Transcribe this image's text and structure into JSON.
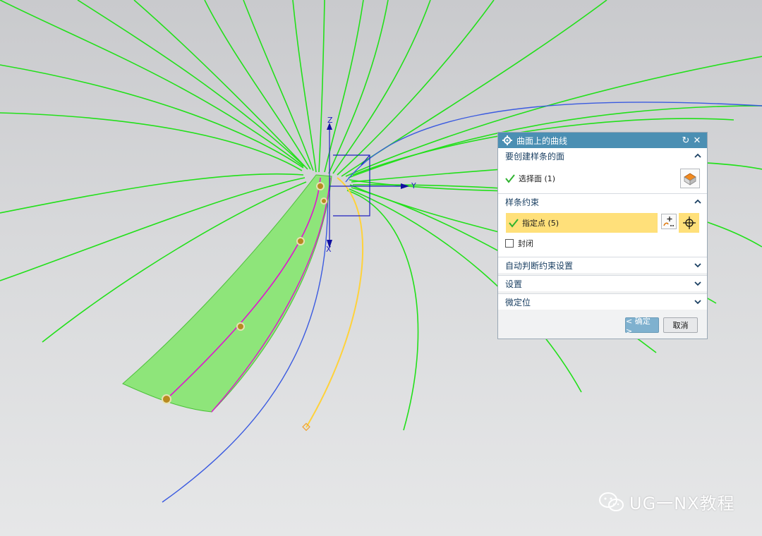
{
  "viewport": {
    "axis_labels": {
      "z": "Z",
      "y": "Y",
      "x": "X"
    }
  },
  "dialog": {
    "title": "曲面上的曲线",
    "sections": {
      "face": {
        "heading": "要创建样条的面",
        "select_label": "选择面 (1)"
      },
      "constraint": {
        "heading": "样条约束",
        "point_label": "指定点 (5)",
        "closed_label": "封闭",
        "closed_checked": false
      },
      "auto": {
        "heading": "自动判断约束设置"
      },
      "settings": {
        "heading": "设置"
      },
      "fine": {
        "heading": "微定位"
      }
    },
    "buttons": {
      "ok": "< 确定 >",
      "cancel": "取消"
    }
  },
  "watermark": {
    "text": "UG一NX教程"
  },
  "colors": {
    "title_bar": "#4b8fb3",
    "highlight": "#ffe07a",
    "curve_green": "#22e01a",
    "curve_blue": "#3a5ae0",
    "curve_yellow": "#ffd23a",
    "curve_magenta": "#e012d0"
  }
}
